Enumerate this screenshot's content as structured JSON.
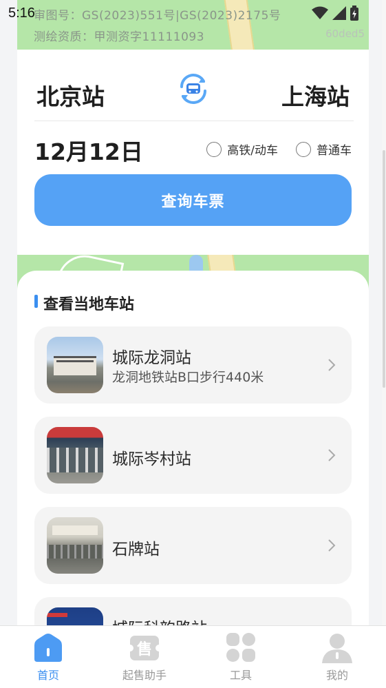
{
  "status_bar": {
    "time": "5:16",
    "wifi_icon": "wifi-icon",
    "signal_icon": "signal-icon",
    "battery_icon": "battery-icon"
  },
  "map_top": {
    "approval_number": "审图号：GS(2023)551号|GS(2023)2175号",
    "survey_qualification": "测绘资质：甲测资字11111093",
    "code": "60ded5"
  },
  "ticket_search": {
    "from_station": "北京站",
    "to_station": "上海站",
    "swap_icon": "train-swap-icon",
    "date": "12月12日",
    "options": [
      {
        "label": "高铁/动车",
        "checked": false
      },
      {
        "label": "普通车",
        "checked": false
      }
    ],
    "query_button": "查询车票"
  },
  "local_stations": {
    "title": "查看当地车站",
    "items": [
      {
        "name": "城际龙洞站",
        "subtitle": "龙洞地铁站B口步行440米"
      },
      {
        "name": "城际岑村站",
        "subtitle": ""
      },
      {
        "name": "石牌站",
        "subtitle": ""
      },
      {
        "name": "城际科韵路站",
        "subtitle": ""
      }
    ]
  },
  "tabs": [
    {
      "label": "首页",
      "icon": "home-icon",
      "active": true
    },
    {
      "label": "起售助手",
      "icon": "sale-icon",
      "active": false
    },
    {
      "label": "工具",
      "icon": "tools-icon",
      "active": false
    },
    {
      "label": "我的",
      "icon": "profile-icon",
      "active": false
    }
  ],
  "colors": {
    "accent": "#55a2f5",
    "active_tab": "#3b8ff0",
    "map_green": "#b5e6a8"
  }
}
